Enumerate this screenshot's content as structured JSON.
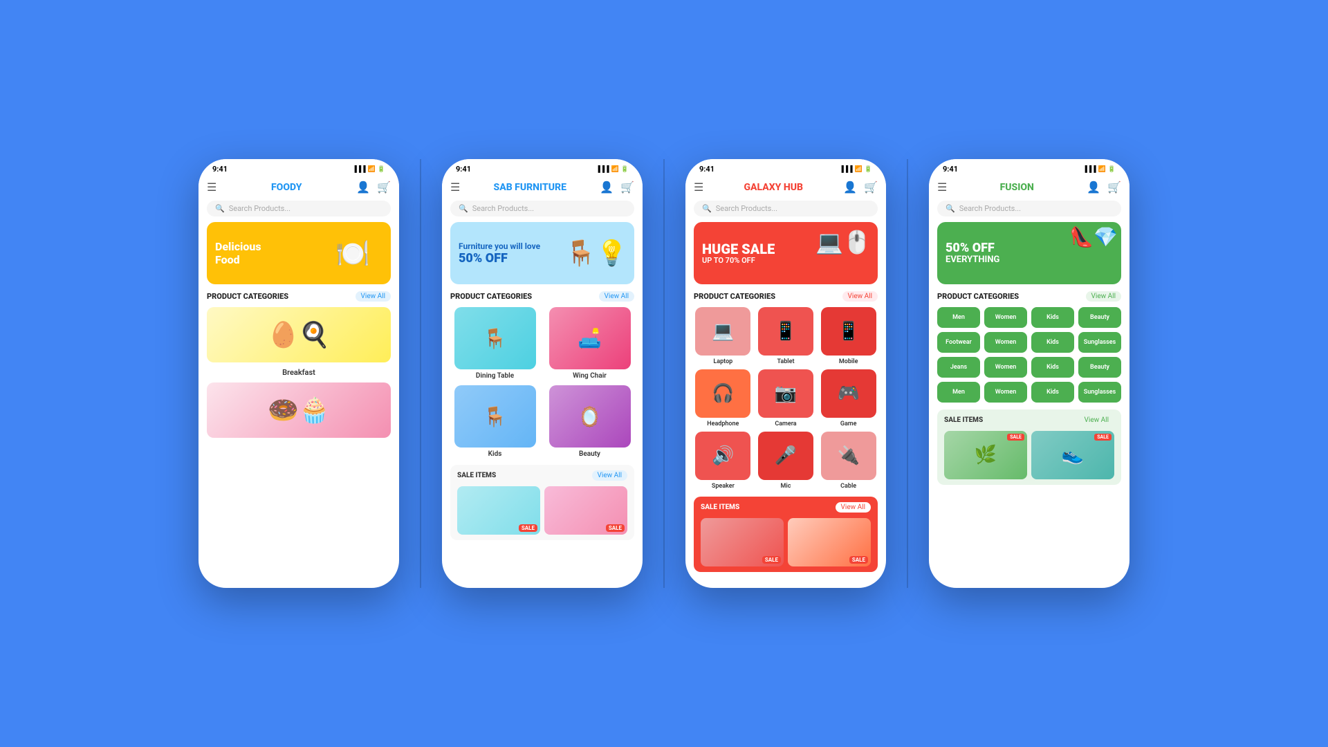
{
  "background": "#4285f4",
  "phones": [
    {
      "id": "foody",
      "time": "9:41",
      "app_name": "FOODY",
      "title_class": "title-foody",
      "search_placeholder": "Search Products...",
      "banner": {
        "text_line1": "Delicious",
        "text_line2": "Food",
        "bg_class": "banner-foody"
      },
      "section_title": "PRODUCT CATEGORIES",
      "view_all": "View All",
      "food_items": [
        {
          "label": "Breakfast",
          "class": "food-breakfast",
          "emoji": "🍳"
        },
        {
          "label": "",
          "class": "food-donuts",
          "emoji": "🍩"
        }
      ]
    },
    {
      "id": "furniture",
      "time": "9:41",
      "app_name": "SAB FURNITURE",
      "title_class": "title-furniture",
      "search_placeholder": "Search Products...",
      "banner": {
        "text_line1": "Furniture you will love",
        "text_line2": "50% OFF",
        "bg_class": "banner-furniture"
      },
      "section_title": "PRODUCT CATEGORIES",
      "view_all": "View All",
      "categories": [
        {
          "label": "Dining Table",
          "class": "img-dining",
          "emoji": "🪑"
        },
        {
          "label": "Wing Chair",
          "class": "img-wing",
          "emoji": "🛋️"
        },
        {
          "label": "Kids",
          "class": "img-kids",
          "emoji": "🪑"
        },
        {
          "label": "Beauty",
          "class": "img-beauty",
          "emoji": "🪞"
        }
      ],
      "sale_title": "SALE ITEMS",
      "sale_view_all": "View All"
    },
    {
      "id": "galaxy",
      "time": "9:41",
      "app_name": "GALAXY HUB",
      "title_class": "title-galaxy",
      "search_placeholder": "Search Products...",
      "banner": {
        "main_text": "HUGE SALE",
        "sub_text": "UP TO 70% OFF",
        "bg_class": "banner-galaxy"
      },
      "section_title": "PRODUCT CATEGORIES",
      "view_all": "View All",
      "categories": [
        {
          "label": "Laptop",
          "class": "img-laptop",
          "emoji": "💻"
        },
        {
          "label": "Tablet",
          "class": "img-tablet",
          "emoji": "📱"
        },
        {
          "label": "Mobile",
          "class": "img-mobile",
          "emoji": "📱"
        },
        {
          "label": "Headphone",
          "class": "img-headphone",
          "emoji": "🎧"
        },
        {
          "label": "Camera",
          "class": "img-camera",
          "emoji": "📷"
        },
        {
          "label": "Game",
          "class": "img-game",
          "emoji": "🎮"
        },
        {
          "label": "Speaker",
          "class": "img-speaker",
          "emoji": "🔊"
        },
        {
          "label": "Mic",
          "class": "img-mic",
          "emoji": "🎤"
        },
        {
          "label": "Cable",
          "class": "img-cable",
          "emoji": "🔌"
        }
      ],
      "sale_title": "SALE ITEMS",
      "sale_view_all": "View All"
    },
    {
      "id": "fusion",
      "time": "9:41",
      "app_name": "FUSION",
      "title_class": "title-fusion",
      "search_placeholder": "Search Products...",
      "banner": {
        "main_text": "50% OFF",
        "sub_text": "EVERYTHING",
        "bg_class": "banner-fusion"
      },
      "section_title": "PRODUCT CATEGORIES",
      "view_all": "View All",
      "categories_row1": [
        "Men",
        "Women",
        "Kids",
        "Beauty"
      ],
      "categories_row2": [
        "Footwear",
        "Women",
        "Kids",
        "Sunglasses"
      ],
      "categories_row3": [
        "Jeans",
        "Women",
        "Kids",
        "Beauty"
      ],
      "categories_row4": [
        "Men",
        "Women",
        "Kids",
        "Sunglasses"
      ],
      "sale_title": "SALE ITEMS",
      "sale_view_all": "View All"
    }
  ],
  "icons": {
    "hamburger": "☰",
    "user": "👤",
    "cart": "🛒",
    "search": "🔍",
    "wifi": "▲",
    "signal": "▐",
    "battery": "▮"
  }
}
